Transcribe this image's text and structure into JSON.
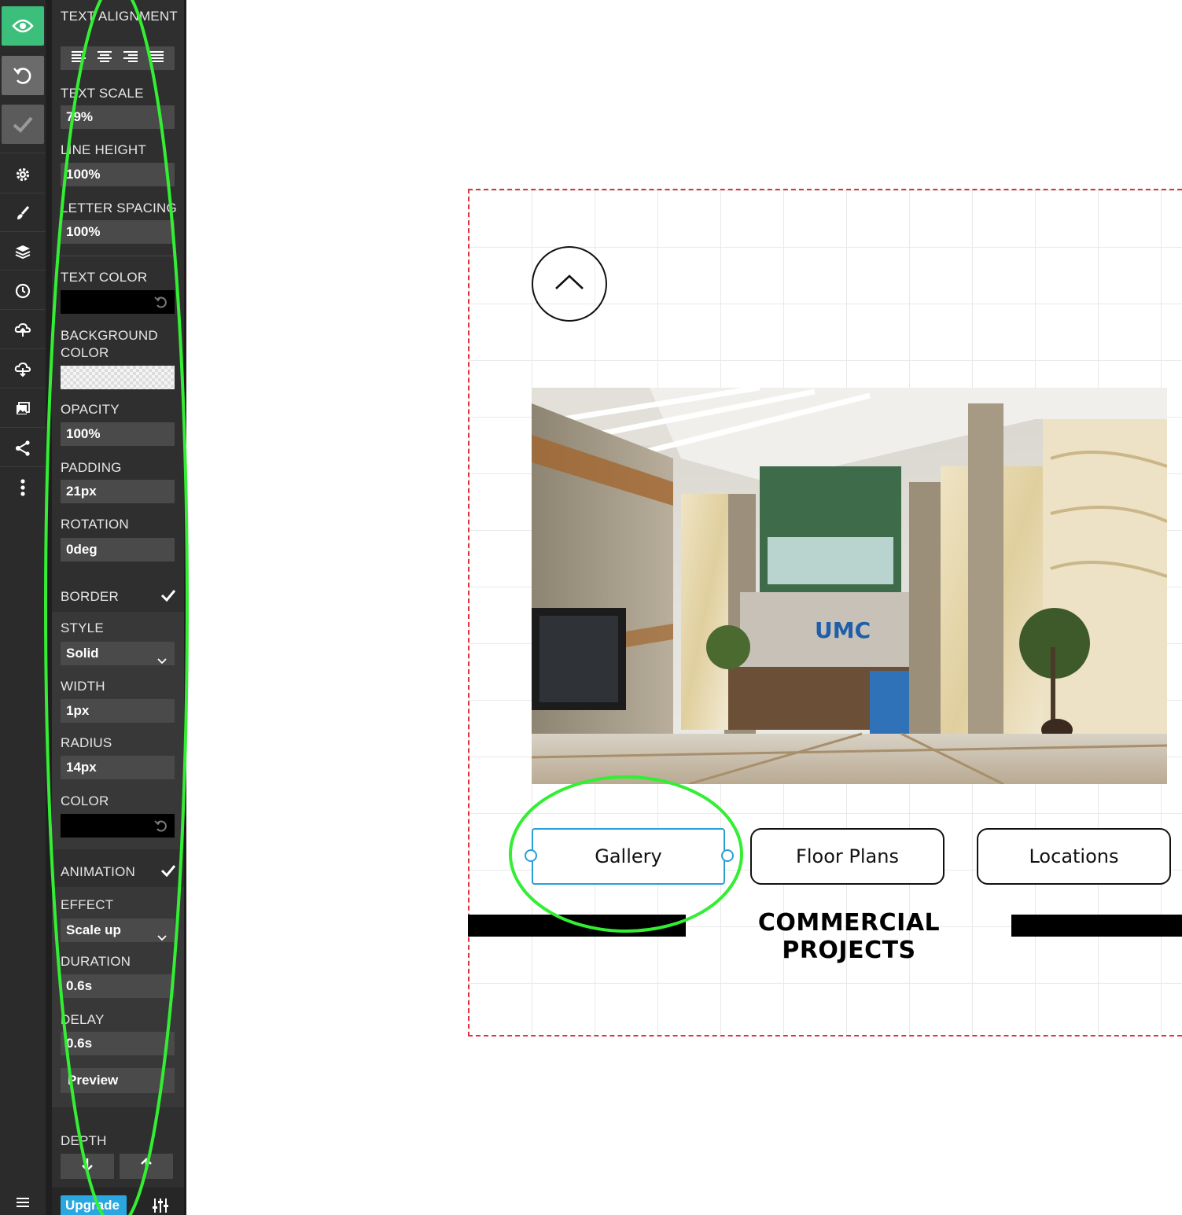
{
  "panel": {
    "text_alignment": {
      "label": "TEXT ALIGNMENT",
      "options": [
        "align-left",
        "align-center",
        "align-right",
        "align-justify"
      ]
    },
    "text_scale": {
      "label": "TEXT SCALE",
      "value": "79%"
    },
    "line_height": {
      "label": "LINE HEIGHT",
      "value": "100%"
    },
    "letter_spacing": {
      "label": "LETTER SPACING",
      "value": "100%"
    },
    "text_color": {
      "label": "TEXT COLOR",
      "value": "#000000"
    },
    "background_color": {
      "label": "BACKGROUND COLOR",
      "value": "transparent"
    },
    "opacity": {
      "label": "OPACITY",
      "value": "100%"
    },
    "padding": {
      "label": "PADDING",
      "value": "21px"
    },
    "rotation": {
      "label": "ROTATION",
      "value": "0deg"
    },
    "border": {
      "label": "BORDER",
      "style_label": "STYLE",
      "style_value": "Solid",
      "width_label": "WIDTH",
      "width_value": "1px",
      "radius_label": "RADIUS",
      "radius_value": "14px",
      "color_label": "COLOR",
      "color_value": "#000000"
    },
    "animation": {
      "label": "ANIMATION",
      "effect_label": "EFFECT",
      "effect_value": "Scale up",
      "duration_label": "DURATION",
      "duration_value": "0.6s",
      "delay_label": "DELAY",
      "delay_value": "0.6s",
      "preview_label": "Preview"
    },
    "depth": {
      "label": "DEPTH"
    },
    "upgrade_label": "Upgrade"
  },
  "rail": {
    "icons": [
      "eye-icon",
      "undo-icon",
      "check-icon",
      "gear-icon",
      "brush-icon",
      "layers-icon",
      "clock-icon",
      "cloud-upload-icon",
      "cloud-download-icon",
      "image-icon",
      "share-icon",
      "more-icon",
      "menu-icon"
    ],
    "accent_color": "#3bbf7a"
  },
  "canvas": {
    "buttons": [
      "Gallery",
      "Floor Plans",
      "Locations"
    ],
    "heading": "COMMERCIAL PROJECTS",
    "selection_color": "#2a9fd6",
    "boundary_color": "#e0323c",
    "annotation_color": "#33ee33"
  }
}
